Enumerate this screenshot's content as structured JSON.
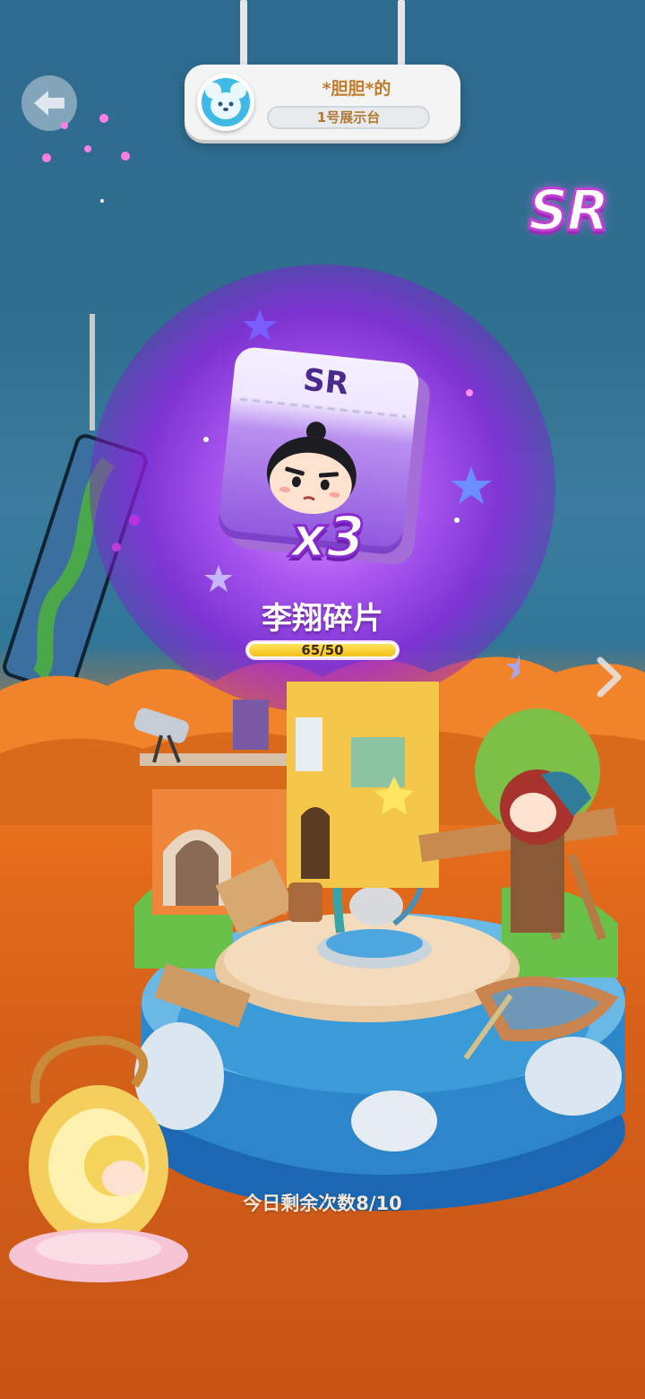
{
  "header": {
    "owner_name": "*胆胆*的",
    "platform_label": "1号展示台"
  },
  "reward": {
    "rarity_badge": "SR",
    "card_rarity": "SR",
    "count_label": "x3",
    "fragment_name": "李翔碎片",
    "progress_text": "65/50",
    "progress_fraction": 1.0
  },
  "footer": {
    "remaining_text": "今日剩余次数8/10"
  },
  "icons": {
    "back": "back-arrow-icon",
    "next": "chevron-right-icon",
    "avatar": "mouse-avatar-icon"
  },
  "colors": {
    "accent_purple": "#9b2bb6",
    "progress_yellow": "#f4c11c",
    "header_text": "#c27b2a"
  }
}
